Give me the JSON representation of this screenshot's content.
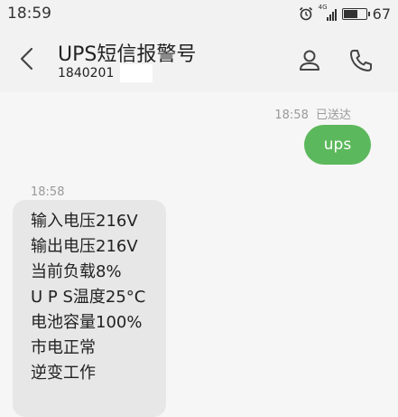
{
  "status_bar": {
    "time": "18:59",
    "network_label": "4G",
    "battery_percent": "67",
    "battery_level": 0.67
  },
  "header": {
    "contact_name": "UPS短信报警号",
    "contact_number": "1840201"
  },
  "messages": {
    "sent": {
      "time": "18:58",
      "status": "已送达",
      "text": "ups"
    },
    "received": {
      "time": "18:58",
      "lines": [
        "输入电压216V",
        "输出电压216V",
        "当前负载8%",
        "U P S温度25°C",
        "电池容量100%",
        "市电正常",
        "逆变工作"
      ]
    }
  },
  "colors": {
    "sent_bubble": "#5cb85c",
    "received_bubble": "#e7e7e7",
    "header_bg": "#f2f2f2"
  }
}
